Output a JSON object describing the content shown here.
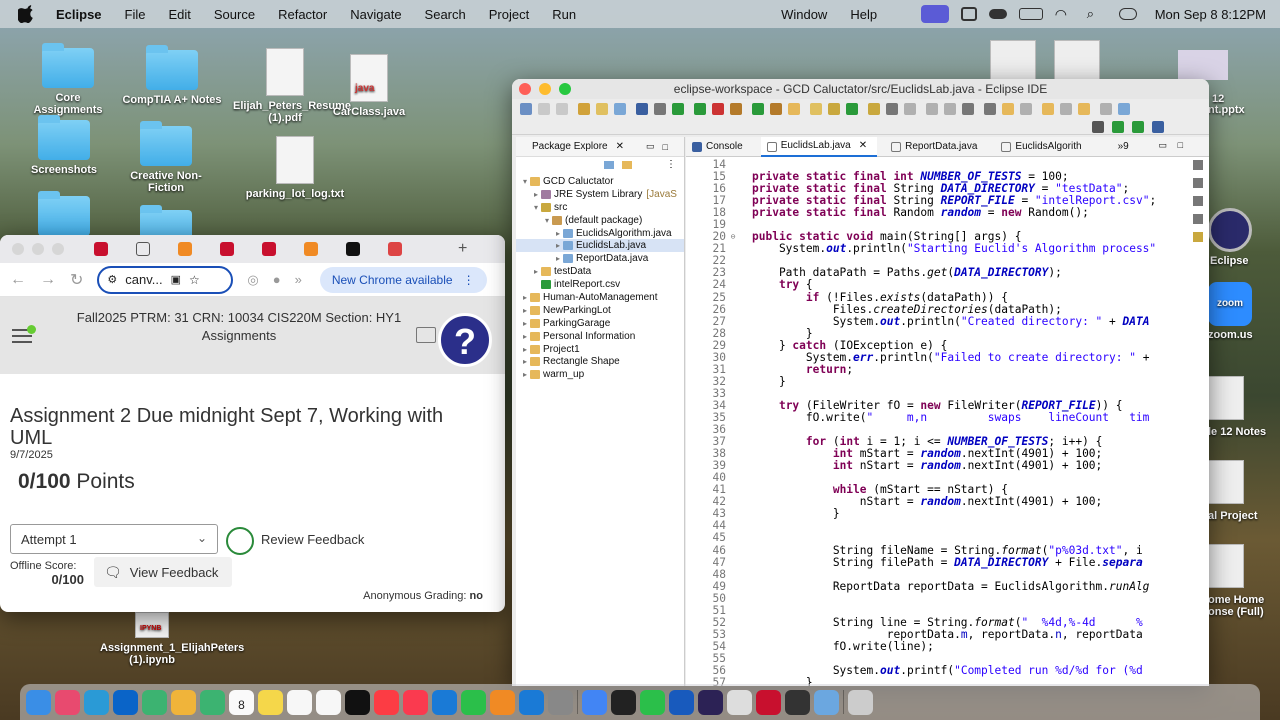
{
  "menubar": {
    "app": "Eclipse",
    "items": [
      "File",
      "Edit",
      "Source",
      "Refactor",
      "Navigate",
      "Search",
      "Project",
      "Run",
      "Window",
      "Help"
    ],
    "clock": "Mon Sep 8  8:12PM"
  },
  "desktop_left": [
    {
      "label": "Core Assignments",
      "kind": "folder"
    },
    {
      "label": "CompTIA A+ Notes",
      "kind": "folder"
    },
    {
      "label": "Elijah_Peters_Resume (1).pdf",
      "kind": "pdf"
    },
    {
      "label": "CarClass.java",
      "kind": "java",
      "badge": "java"
    },
    {
      "label": "Screenshots",
      "kind": "folder"
    },
    {
      "label": "Creative Non-Fiction",
      "kind": "folder"
    },
    {
      "label": "parking_lot_log.txt",
      "kind": "txt"
    },
    {
      "label": "Assignment_1_ElijahPeters (1).ipynb",
      "kind": "ipynb",
      "badge": "IPYNB"
    }
  ],
  "desktop_right": [
    "12",
    "nt.pptx",
    "Eclipse",
    "zoom",
    "zoom.us",
    "le 12 Notes",
    "al Project",
    "ome Home",
    "onse (Full)"
  ],
  "chrome": {
    "omnibox": "canv...",
    "new_chrome": "New Chrome available",
    "course_title": "Fall2025 PTRM: 31 CRN: 10034 CIS220M Section: HY1",
    "course_sub": "Assignments",
    "help_glyph": "?",
    "assignment_title": "Assignment 2 Due midnight Sept 7, Working with UML",
    "date": "9/7/2025",
    "points_score": "0/100",
    "points_label": "Points",
    "attempt": "Attempt 1",
    "review_feedback": "Review Feedback",
    "offline_label": "Offline Score:",
    "offline_score": "0/100",
    "view_feedback": "View Feedback",
    "anon_label": "Anonymous Grading:",
    "anon_value": "no"
  },
  "eclipse": {
    "window_title": "eclipse-workspace - GCD Caluctator/src/EuclidsLab.java - Eclipse IDE",
    "pkg_tab": "Package Explore",
    "tree": [
      {
        "label": "GCD Caluctator",
        "level": 0,
        "twisty": "▾"
      },
      {
        "label": "JRE System Library",
        "suffix": "[JavaS",
        "level": 1,
        "twisty": "▸"
      },
      {
        "label": "src",
        "level": 1,
        "twisty": "▾"
      },
      {
        "label": "(default package)",
        "level": 2,
        "twisty": "▾"
      },
      {
        "label": "EuclidsAlgorithm.java",
        "level": 3,
        "twisty": "▸"
      },
      {
        "label": "EuclidsLab.java",
        "level": 3,
        "twisty": "▸",
        "selected": true
      },
      {
        "label": "ReportData.java",
        "level": 3,
        "twisty": "▸"
      },
      {
        "label": "testData",
        "level": 1,
        "twisty": "▸"
      },
      {
        "label": "intelReport.csv",
        "level": 1,
        "twisty": ""
      },
      {
        "label": "Human-AutoManagement",
        "level": 0,
        "twisty": "▸"
      },
      {
        "label": "NewParkingLot",
        "level": 0,
        "twisty": "▸"
      },
      {
        "label": "ParkingGarage",
        "level": 0,
        "twisty": "▸"
      },
      {
        "label": "Personal Information",
        "level": 0,
        "twisty": "▸"
      },
      {
        "label": "Project1",
        "level": 0,
        "twisty": "▸"
      },
      {
        "label": "Rectangle Shape",
        "level": 0,
        "twisty": "▸"
      },
      {
        "label": "warm_up",
        "level": 0,
        "twisty": "▸"
      }
    ],
    "editor_tabs": [
      "Console",
      "EuclidsLab.java",
      "ReportData.java",
      "EuclidsAlgorith"
    ],
    "overflow": "»9",
    "code": [
      {
        "n": "14",
        "f": "",
        "html": ""
      },
      {
        "n": "15",
        "f": "",
        "html": "<span class=\"kw\">private static final int</span> <span class=\"fi\">NUMBER_OF_TESTS</span> = 100;"
      },
      {
        "n": "16",
        "f": "",
        "html": "<span class=\"kw\">private static final</span> String <span class=\"fi\">DATA_DIRECTORY</span> = <span class=\"st\">\"testData\"</span>;"
      },
      {
        "n": "17",
        "f": "",
        "html": "<span class=\"kw\">private static final</span> String <span class=\"fi\">REPORT_FILE</span> = <span class=\"st\">\"intelReport.csv\"</span>;"
      },
      {
        "n": "18",
        "f": "",
        "html": "<span class=\"kw\">private static final</span> Random <span class=\"fi\">random</span> = <span class=\"kw\">new</span> Random();"
      },
      {
        "n": "19",
        "f": "",
        "html": ""
      },
      {
        "n": "20",
        "f": "⊖",
        "html": "<span class=\"kw\">public static void</span> main(String[] args) {"
      },
      {
        "n": "21",
        "f": "",
        "html": "    System.<span class=\"fi\">out</span>.println(<span class=\"st\">\"Starting Euclid's Algorithm process\"</span>"
      },
      {
        "n": "22",
        "f": "",
        "html": ""
      },
      {
        "n": "23",
        "f": "",
        "html": "    Path dataPath = Paths.<span class=\"it\">get</span>(<span class=\"fi\">DATA_DIRECTORY</span>);"
      },
      {
        "n": "24",
        "f": "",
        "html": "    <span class=\"kw\">try</span> {"
      },
      {
        "n": "25",
        "f": "",
        "html": "        <span class=\"kw\">if</span> (!Files.<span class=\"it\">exists</span>(dataPath)) {"
      },
      {
        "n": "26",
        "f": "",
        "html": "            Files.<span class=\"it\">createDirectories</span>(dataPath);"
      },
      {
        "n": "27",
        "f": "",
        "html": "            System.<span class=\"fi\">out</span>.println(<span class=\"st\">\"Created directory: \"</span> + <span class=\"fi\">DATA</span>"
      },
      {
        "n": "28",
        "f": "",
        "html": "        }"
      },
      {
        "n": "29",
        "f": "",
        "html": "    } <span class=\"kw\">catch</span> (IOException e) {"
      },
      {
        "n": "30",
        "f": "",
        "html": "        System.<span class=\"fi\">err</span>.println(<span class=\"st\">\"Failed to create directory: \"</span> +"
      },
      {
        "n": "31",
        "f": "",
        "html": "        <span class=\"kw\">return</span>;"
      },
      {
        "n": "32",
        "f": "",
        "html": "    }"
      },
      {
        "n": "33",
        "f": "",
        "html": ""
      },
      {
        "n": "34",
        "f": "",
        "html": "    <span class=\"kw\">try</span> (FileWriter fO = <span class=\"kw\">new</span> FileWriter(<span class=\"fi\">REPORT_FILE</span>)) {"
      },
      {
        "n": "35",
        "f": "",
        "html": "        fO.write(<span class=\"st\">\"     m,n         swaps    lineCount   tim</span>"
      },
      {
        "n": "36",
        "f": "",
        "html": ""
      },
      {
        "n": "37",
        "f": "",
        "html": "        <span class=\"kw\">for</span> (<span class=\"kw\">int</span> i = 1; i &lt;= <span class=\"fi\">NUMBER_OF_TESTS</span>; i++) {"
      },
      {
        "n": "38",
        "f": "",
        "html": "            <span class=\"kw\">int</span> mStart = <span class=\"fi\">random</span>.nextInt(4901) + 100;"
      },
      {
        "n": "39",
        "f": "",
        "html": "            <span class=\"kw\">int</span> nStart = <span class=\"fi\">random</span>.nextInt(4901) + 100;"
      },
      {
        "n": "40",
        "f": "",
        "html": ""
      },
      {
        "n": "41",
        "f": "",
        "html": "            <span class=\"kw\">while</span> (mStart == nStart) {"
      },
      {
        "n": "42",
        "f": "",
        "html": "                nStart = <span class=\"fi\">random</span>.nextInt(4901) + 100;"
      },
      {
        "n": "43",
        "f": "",
        "html": "            }"
      },
      {
        "n": "44",
        "f": "",
        "html": ""
      },
      {
        "n": "45",
        "f": "",
        "html": ""
      },
      {
        "n": "46",
        "f": "",
        "html": "            String fileName = String.<span class=\"it\">format</span>(<span class=\"st\">\"p%03d.txt\"</span>, i"
      },
      {
        "n": "47",
        "f": "",
        "html": "            String filePath = <span class=\"fi\">DATA_DIRECTORY</span> + File.<span class=\"fi\">separa</span>"
      },
      {
        "n": "48",
        "f": "",
        "html": ""
      },
      {
        "n": "49",
        "f": "",
        "html": "            ReportData reportData = EuclidsAlgorithm.<span class=\"it\">runAlg</span>"
      },
      {
        "n": "50",
        "f": "",
        "html": ""
      },
      {
        "n": "51",
        "f": "",
        "html": ""
      },
      {
        "n": "52",
        "f": "",
        "html": "            String line = String.<span class=\"it\">format</span>(<span class=\"st\">\"  %4d,%-4d      %</span>"
      },
      {
        "n": "53",
        "f": "",
        "html": "                    reportData.<span class=\"fl\">m</span>, reportData.<span class=\"fl\">n</span>, reportData"
      },
      {
        "n": "54",
        "f": "",
        "html": "            fO.write(line);"
      },
      {
        "n": "55",
        "f": "",
        "html": ""
      },
      {
        "n": "56",
        "f": "",
        "html": "            System.<span class=\"fi\">out</span>.printf(<span class=\"st\">\"Completed run %d/%d for (%d</span>"
      },
      {
        "n": "57",
        "f": "",
        "html": "        }"
      }
    ]
  },
  "dock_apps": [
    "finder-icon",
    "launchpad-icon",
    "safari-icon",
    "outlook-icon",
    "maps-icon",
    "photos-icon",
    "facetime-icon",
    "calendar-icon",
    "notes-icon",
    "reminders-icon",
    "freeform-icon",
    "appletv-icon",
    "music-icon",
    "news-icon",
    "keynote-icon",
    "numbers-icon",
    "pages-icon",
    "appstore-icon",
    "settings-icon",
    "chrome-icon",
    "terminal-icon",
    "progress-icon",
    "word-icon",
    "eclipse-icon",
    "pen-icon",
    "acrobat-icon",
    "screenshot-icon",
    "folder-icon",
    "trash-icon"
  ],
  "dock_calendar_day": "8",
  "dock_calendar_month": "SEP"
}
